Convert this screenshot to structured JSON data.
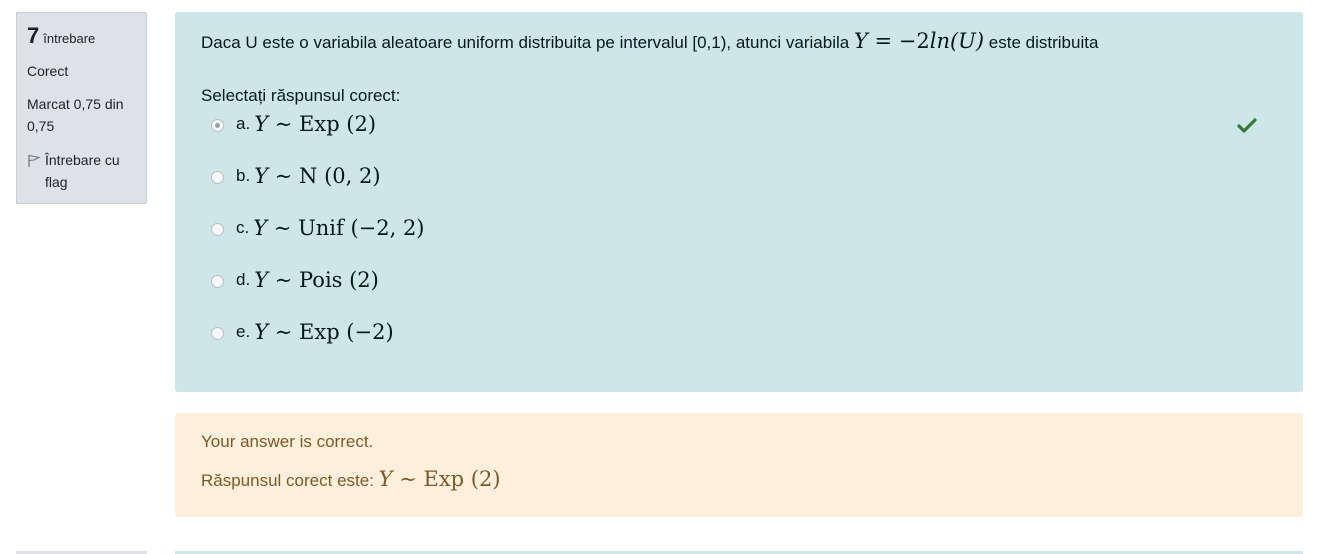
{
  "info": {
    "number": "7",
    "question_word": "întrebare",
    "state": "Corect",
    "grade": "Marcat 0,75 din 0,75",
    "flag_label": "Întrebare cu flag"
  },
  "question": {
    "text_prefix": "Daca U este o variabila aleatoare uniform distribuita pe intervalul [0,1), atunci variabila ",
    "math_Y": "Y",
    "math_eq": " = −2",
    "math_ln": "ln",
    "math_U": "(U)",
    "text_suffix": " este distribuita",
    "prompt": "Selectați răspunsul corect:"
  },
  "answers": [
    {
      "letter": "a.",
      "var": "Y",
      "sim": " ∼ ",
      "dist": "Exp (2)",
      "selected": true
    },
    {
      "letter": "b.",
      "var": "Y",
      "sim": " ∼ ",
      "dist": "N (0, 2)",
      "selected": false
    },
    {
      "letter": "c.",
      "var": "Y",
      "sim": " ∼ ",
      "dist": "Unif (−2, 2)",
      "selected": false
    },
    {
      "letter": "d.",
      "var": "Y",
      "sim": " ∼ ",
      "dist": "Pois (2)",
      "selected": false
    },
    {
      "letter": "e.",
      "var": "Y",
      "sim": " ∼ ",
      "dist": "Exp (−2)",
      "selected": false
    }
  ],
  "outcome": {
    "feedback": "Your answer is correct.",
    "right_prefix": "Răspunsul corect este: ",
    "right_var": "Y",
    "right_sim": " ∼ ",
    "right_dist": "Exp (2)"
  },
  "icons": {
    "correct": "check-icon",
    "flag": "flag-icon"
  },
  "colors": {
    "correct_tick": "#357a32",
    "formulation_bg": "#cce6ea",
    "outcome_bg": "#fcefdc"
  }
}
